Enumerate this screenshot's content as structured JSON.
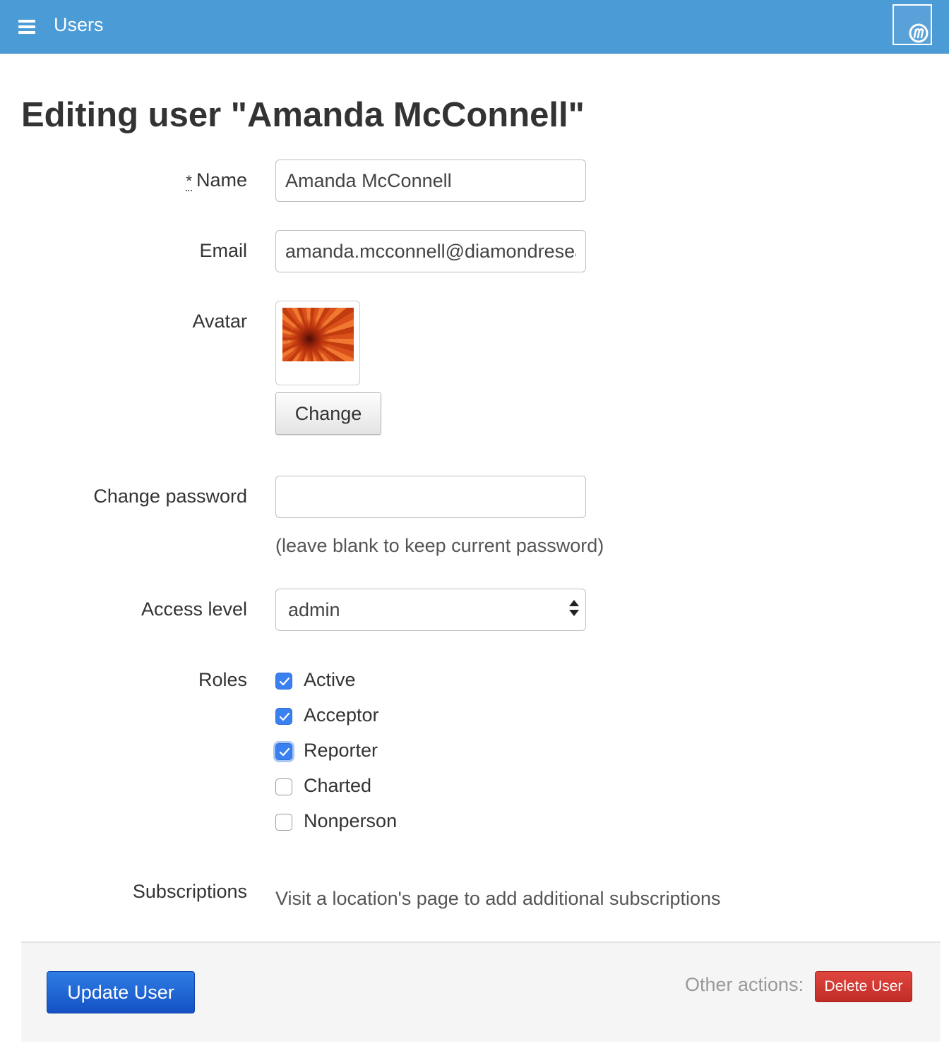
{
  "nav": {
    "menu_icon": "hamburger-icon",
    "title": "Users",
    "logo_icon": "app-logo-m"
  },
  "page": {
    "title": "Editing user \"Amanda McConnell\""
  },
  "form": {
    "name": {
      "required_marker": "*",
      "label": "Name",
      "value": "Amanda McConnell"
    },
    "email": {
      "label": "Email",
      "value": "amanda.mcconnell@diamondresearch.org"
    },
    "avatar": {
      "label": "Avatar",
      "change_label": "Change"
    },
    "password": {
      "label": "Change password",
      "value": "",
      "help": "(leave blank to keep current password)"
    },
    "access_level": {
      "label": "Access level",
      "selected": "admin"
    },
    "roles": {
      "label": "Roles",
      "items": [
        {
          "label": "Active",
          "checked": true
        },
        {
          "label": "Acceptor",
          "checked": true
        },
        {
          "label": "Reporter",
          "checked": true
        },
        {
          "label": "Charted",
          "checked": false
        },
        {
          "label": "Nonperson",
          "checked": false
        }
      ]
    },
    "subscriptions": {
      "label": "Subscriptions",
      "text": "Visit a location's page to add additional subscriptions"
    }
  },
  "footer": {
    "update_label": "Update User",
    "other_actions_label": "Other actions:",
    "delete_label": "Delete User"
  },
  "colors": {
    "header_bg": "#4a9bd6",
    "primary_button": "#1f63d4",
    "danger_button": "#d03a33",
    "checkbox_checked": "#3b80f0"
  }
}
